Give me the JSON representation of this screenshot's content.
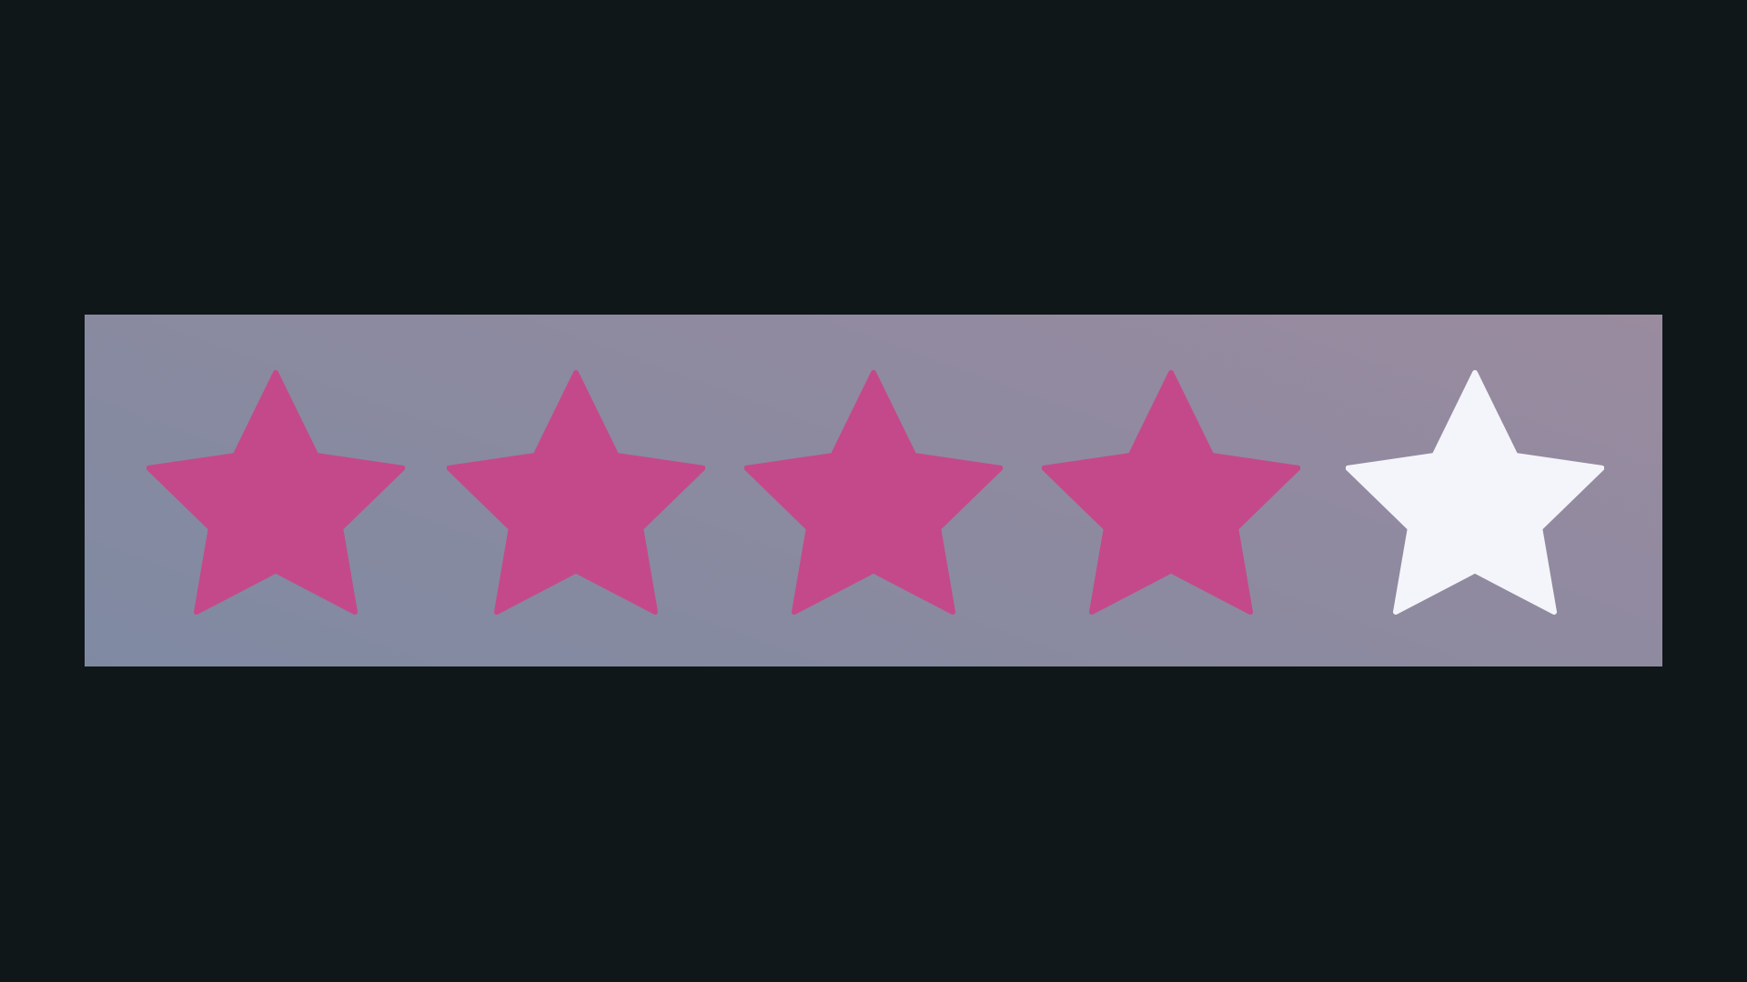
{
  "rating": {
    "value": 4,
    "max": 5,
    "filled_color": "#c4498b",
    "empty_color": "#f4f5fa",
    "background_color": "#0f1719",
    "stars": [
      {
        "icon": "star-icon",
        "filled": true
      },
      {
        "icon": "star-icon",
        "filled": true
      },
      {
        "icon": "star-icon",
        "filled": true
      },
      {
        "icon": "star-icon",
        "filled": true
      },
      {
        "icon": "star-icon",
        "filled": false
      }
    ]
  }
}
